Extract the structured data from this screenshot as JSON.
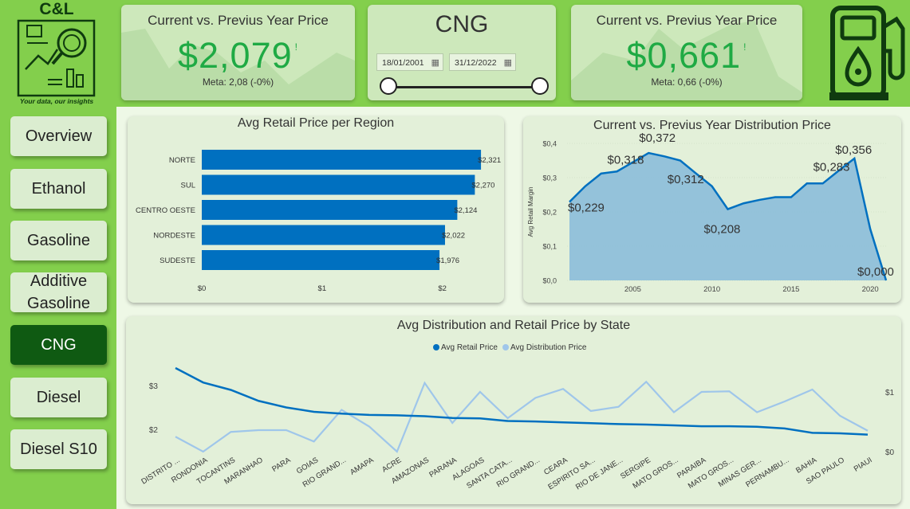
{
  "logo": {
    "title": "C&L",
    "tagline": "Your data, our insights"
  },
  "kpi_left": {
    "title": "Current vs. Previus Year Price",
    "value": "$2,079",
    "flag": "!",
    "meta": "Meta: 2,08 (-0%)"
  },
  "kpi_right": {
    "title": "Current vs. Previus Year Price",
    "value": "$0,661",
    "flag": "!",
    "meta": "Meta: 0,66 (-0%)"
  },
  "header": {
    "title": "CNG"
  },
  "date_range": {
    "start": "18/01/2001",
    "end": "31/12/2022"
  },
  "nav": {
    "overview": "Overview",
    "ethanol": "Ethanol",
    "gasoline": "Gasoline",
    "additive_1": "Additive",
    "additive_2": "Gasoline",
    "cng": "CNG",
    "diesel": "Diesel",
    "diesel_s10": "Diesel S10"
  },
  "colors": {
    "accent": "#0070c0",
    "light_series": "#9fc6ea",
    "active_nav": "#0f5a12",
    "kpi_value": "#1faa44",
    "area_fill": "#8bbdd9"
  },
  "chart_data": [
    {
      "type": "bar",
      "title": "Avg Retail Price per Region",
      "categories": [
        "NORTE",
        "SUL",
        "CENTRO OESTE",
        "NORDESTE",
        "SUDESTE"
      ],
      "values": [
        2.321,
        2.27,
        2.124,
        2.022,
        1.976
      ],
      "value_labels": [
        "$2,321",
        "$2,270",
        "$2,124",
        "$2,022",
        "$1,976"
      ],
      "x_ticks": [
        "$0",
        "$1",
        "$2"
      ],
      "xlim": [
        0,
        2.4
      ]
    },
    {
      "type": "area",
      "title": "Current vs. Previus Year Distribution Price",
      "ylabel": "Avg Retail Margin",
      "x": [
        2001,
        2002,
        2003,
        2004,
        2005,
        2006,
        2007,
        2008,
        2009,
        2010,
        2011,
        2012,
        2013,
        2014,
        2015,
        2016,
        2017,
        2018,
        2019,
        2020,
        2021
      ],
      "values": [
        0.229,
        0.275,
        0.312,
        0.318,
        0.345,
        0.372,
        0.362,
        0.35,
        0.312,
        0.275,
        0.208,
        0.225,
        0.235,
        0.243,
        0.243,
        0.283,
        0.283,
        0.32,
        0.356,
        0.15,
        0.0
      ],
      "data_labels": [
        {
          "x": 2001,
          "label": "$0,229"
        },
        {
          "x": 2004,
          "label": "$0,318"
        },
        {
          "x": 2006,
          "label": "$0,372"
        },
        {
          "x": 2009,
          "label": "$0,312"
        },
        {
          "x": 2011,
          "label": "$0,208"
        },
        {
          "x": 2017,
          "label": "$0,283"
        },
        {
          "x": 2019,
          "label": "$0,356"
        },
        {
          "x": 2021,
          "label": "$0,000"
        }
      ],
      "y_ticks": [
        "$0,0",
        "$0,1",
        "$0,2",
        "$0,3",
        "$0,4"
      ],
      "x_ticks": [
        "2005",
        "2010",
        "2015",
        "2020"
      ],
      "ylim": [
        0,
        0.4
      ]
    },
    {
      "type": "line",
      "title": "Avg Distribution and Retail Price by State",
      "categories": [
        "DISTRITO ...",
        "RONDONIA",
        "TOCANTINS",
        "MARANHAO",
        "PARA",
        "GOIAS",
        "RIO GRAND...",
        "AMAPA",
        "ACRE",
        "AMAZONAS",
        "PARANA",
        "ALAGOAS",
        "SANTA CATA...",
        "RIO GRAND...",
        "CEARA",
        "ESPIRITO SA...",
        "RIO DE JANE...",
        "SERGIPE",
        "MATO GROS...",
        "PARAIBA",
        "MATO GROS...",
        "MINAS GER...",
        "PERNAMBU...",
        "BAHIA",
        "SAO PAULO",
        "PIAUI"
      ],
      "series": [
        {
          "name": "Avg Retail Price",
          "axis": "left",
          "values": [
            3.4,
            3.07,
            2.9,
            2.65,
            2.5,
            2.4,
            2.36,
            2.33,
            2.32,
            2.3,
            2.26,
            2.25,
            2.19,
            2.18,
            2.16,
            2.14,
            2.12,
            2.11,
            2.09,
            2.07,
            2.07,
            2.06,
            2.02,
            1.92,
            1.91,
            1.88
          ]
        },
        {
          "name": "Avg Distribution Price",
          "axis": "right",
          "values": [
            0.25,
            0.0,
            0.33,
            0.36,
            0.36,
            0.17,
            0.7,
            0.42,
            0.0,
            1.15,
            0.48,
            1.0,
            0.56,
            0.9,
            1.05,
            0.68,
            0.75,
            1.17,
            0.66,
            1.0,
            1.01,
            0.66,
            0.84,
            1.04,
            0.6,
            0.35
          ]
        }
      ],
      "left_ticks": [
        "$2",
        "$3"
      ],
      "right_ticks": [
        "$0",
        "$1"
      ],
      "legend": "top"
    }
  ]
}
